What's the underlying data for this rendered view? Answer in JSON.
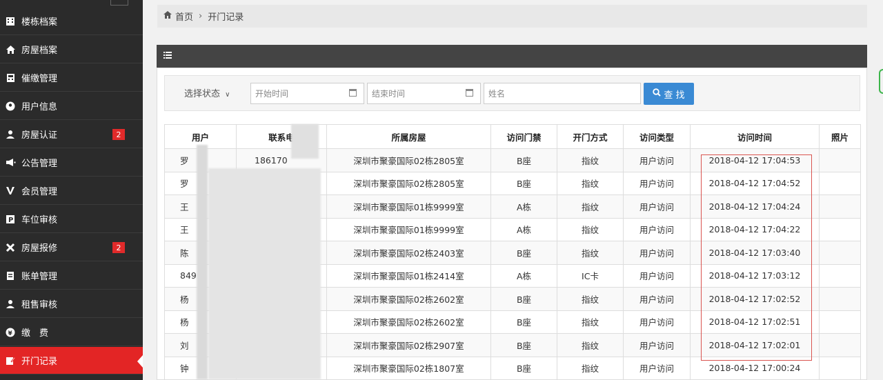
{
  "sidebar": {
    "items": [
      {
        "label": "楼栋档案",
        "icon": "building-icon"
      },
      {
        "label": "房屋档案",
        "icon": "home-icon"
      },
      {
        "label": "催缴管理",
        "icon": "calculator-icon"
      },
      {
        "label": "用户信息",
        "icon": "user-circle-icon"
      },
      {
        "label": "房屋认证",
        "icon": "user-icon",
        "badge": "2"
      },
      {
        "label": "公告管理",
        "icon": "megaphone-icon"
      },
      {
        "label": "会员管理",
        "icon": "vip-icon"
      },
      {
        "label": "车位审核",
        "icon": "parking-icon"
      },
      {
        "label": "房屋报修",
        "icon": "wrench-icon",
        "badge": "2"
      },
      {
        "label": "账单管理",
        "icon": "file-icon"
      },
      {
        "label": "租售审核",
        "icon": "user-tie-icon"
      },
      {
        "label": "缴　费",
        "icon": "money-icon"
      },
      {
        "label": "开门记录",
        "icon": "edit-icon",
        "active": true
      }
    ]
  },
  "breadcrumb": {
    "home": "首页",
    "current": "开门记录"
  },
  "filter": {
    "status_label": "选择状态",
    "start_placeholder": "开始时间",
    "end_placeholder": "结束时间",
    "name_placeholder": "姓名",
    "search_label": "查 找"
  },
  "table": {
    "headers": [
      "用户",
      "联系电",
      "所属房屋",
      "访问门禁",
      "开门方式",
      "访问类型",
      "访问时间",
      "照片"
    ],
    "rows": [
      {
        "user": "罗",
        "phone": "186170",
        "room": "深圳市聚豪国际02栋2805室",
        "gate": "B座",
        "method": "指纹",
        "type": "用户访问",
        "time": "2018-04-12 17:04:53"
      },
      {
        "user": "罗",
        "phone": "",
        "room": "深圳市聚豪国际02栋2805室",
        "gate": "B座",
        "method": "指纹",
        "type": "用户访问",
        "time": "2018-04-12 17:04:52"
      },
      {
        "user": "王",
        "phone": "",
        "room": "深圳市聚豪国际01栋9999室",
        "gate": "A栋",
        "method": "指纹",
        "type": "用户访问",
        "time": "2018-04-12 17:04:24"
      },
      {
        "user": "王",
        "phone": "",
        "room": "深圳市聚豪国际01栋9999室",
        "gate": "A栋",
        "method": "指纹",
        "type": "用户访问",
        "time": "2018-04-12 17:04:22"
      },
      {
        "user": "陈",
        "phone": "",
        "room": "深圳市聚豪国际02栋2403室",
        "gate": "B座",
        "method": "指纹",
        "type": "用户访问",
        "time": "2018-04-12 17:03:40"
      },
      {
        "user": "849",
        "phone": "",
        "room": "深圳市聚豪国际01栋2414室",
        "gate": "A栋",
        "method": "IC卡",
        "type": "用户访问",
        "time": "2018-04-12 17:03:12"
      },
      {
        "user": "杨",
        "phone": "",
        "room": "深圳市聚豪国际02栋2602室",
        "gate": "B座",
        "method": "指纹",
        "type": "用户访问",
        "time": "2018-04-12 17:02:52"
      },
      {
        "user": "杨",
        "phone": "",
        "room": "深圳市聚豪国际02栋2602室",
        "gate": "B座",
        "method": "指纹",
        "type": "用户访问",
        "time": "2018-04-12 17:02:51"
      },
      {
        "user": "刘",
        "phone": "",
        "room": "深圳市聚豪国际02栋2907室",
        "gate": "B座",
        "method": "指纹",
        "type": "用户访问",
        "time": "2018-04-12 17:02:01"
      },
      {
        "user": "钟",
        "phone": "",
        "room": "深圳市聚豪国际02栋1807室",
        "gate": "B座",
        "method": "指纹",
        "type": "用户访问",
        "time": "2018-04-12 17:00:24"
      }
    ]
  }
}
